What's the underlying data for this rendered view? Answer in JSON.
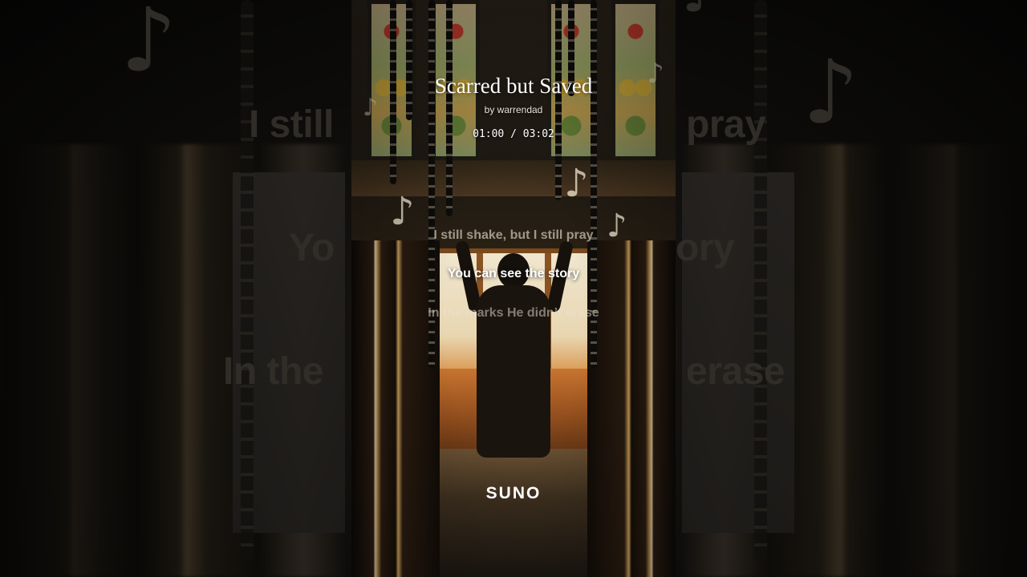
{
  "song": {
    "title": "Scarred but Saved",
    "artist": "by warrendad",
    "time": "01:00 / 03:02"
  },
  "lyrics": {
    "previous": "I still shake, but I still pray",
    "current": "You can see the story",
    "next": "In the marks He didn’t erase"
  },
  "backdrop": {
    "line_top_left": "I still",
    "line_top_right": "pray",
    "line_mid_left": "Yo",
    "line_mid_right": "ory",
    "line_bottom_left": "In the",
    "line_bottom_right": "erase"
  },
  "brand": {
    "logo": "SUNO"
  },
  "icons": {
    "note": "music-note-icon"
  }
}
